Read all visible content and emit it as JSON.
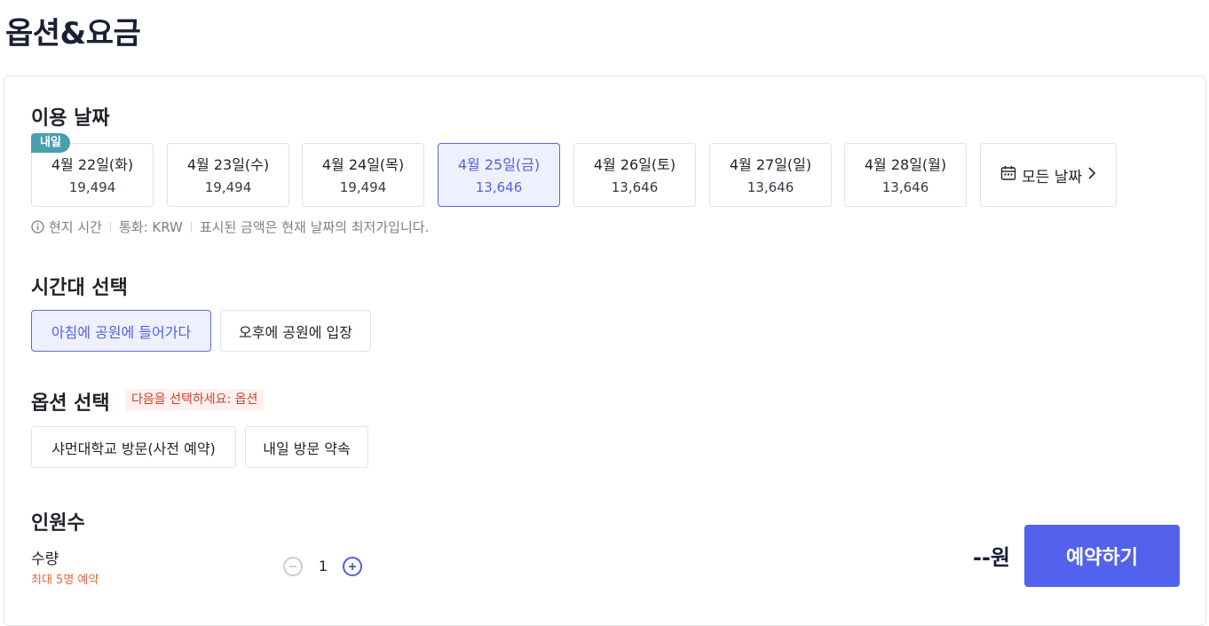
{
  "header": {
    "title": "옵션&요금"
  },
  "date_section": {
    "title": "이용 날짜",
    "tomorrow_badge": "내일",
    "dates": [
      {
        "label": "4월 22일(화)",
        "price": "19,494"
      },
      {
        "label": "4월 23일(수)",
        "price": "19,494"
      },
      {
        "label": "4월 24일(목)",
        "price": "19,494"
      },
      {
        "label": "4월 25일(금)",
        "price": "13,646",
        "selected": true
      },
      {
        "label": "4월 26일(토)",
        "price": "13,646"
      },
      {
        "label": "4월 27일(일)",
        "price": "13,646"
      },
      {
        "label": "4월 28일(월)",
        "price": "13,646"
      }
    ],
    "all_dates_label": "모든 날짜",
    "info": {
      "local_time": "현지 시간",
      "currency": "통화: KRW",
      "note": "표시된 금액은 현재 날짜의 최저가입니다."
    }
  },
  "time_section": {
    "title": "시간대 선택",
    "slots": [
      {
        "label": "아침에 공원에 들어가다",
        "selected": true
      },
      {
        "label": "오후에 공원에 입장",
        "selected": false
      }
    ]
  },
  "option_section": {
    "title": "옵션 선택",
    "hint": "다음을 선택하세요: 옵션",
    "options": [
      {
        "label": "샤먼대학교 방문(사전 예약)"
      },
      {
        "label": "내일 방문 약속"
      }
    ]
  },
  "people_section": {
    "title": "인원수",
    "quantity_label": "수량",
    "max_note": "최대 5명 예약",
    "quantity": "1"
  },
  "footer": {
    "total": "--원",
    "book_label": "예약하기"
  },
  "colors": {
    "accent": "#5362ec",
    "selected_border": "#5b6ad6",
    "selected_bg": "#eef0fd",
    "badge": "#4a9fae",
    "warning": "#c9442e"
  }
}
